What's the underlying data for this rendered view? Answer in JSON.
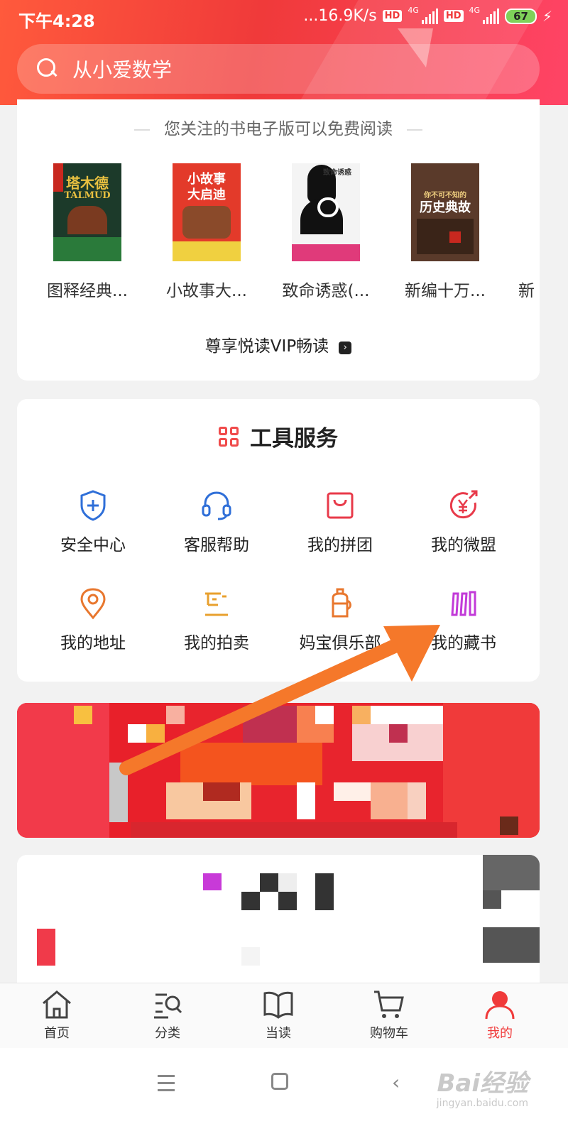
{
  "status_bar": {
    "time": "下午4:28",
    "speed": "...16.9K/s",
    "hd": "HD",
    "network": "4G",
    "battery": "67"
  },
  "search": {
    "placeholder": "从小爱数学"
  },
  "free_section": {
    "title": "您关注的书电子版可以免费阅读",
    "books": [
      {
        "label": "图释经典...",
        "cover_title": "塔木德",
        "cover_sub": "TALMUD"
      },
      {
        "label": "小故事大...",
        "cover_title": "小故事",
        "cover_sub": "大启迪"
      },
      {
        "label": "致命诱惑(...",
        "cover_title": "致命诱惑",
        "cover_sub": ""
      },
      {
        "label": "新编十万...",
        "cover_title": "历史典故",
        "cover_sub": "你不可不知的"
      },
      {
        "label": "新",
        "cover_title": "",
        "cover_sub": ""
      }
    ],
    "vip_link": "尊享悦读VIP畅读"
  },
  "tools": {
    "title": "工具服务",
    "items": [
      {
        "label": "安全中心",
        "icon": "shield-plus-icon",
        "color": "#2f6fd8"
      },
      {
        "label": "客服帮助",
        "icon": "headset-icon",
        "color": "#2f6fd8"
      },
      {
        "label": "我的拼团",
        "icon": "shopping-bag-icon",
        "color": "#e83a4a"
      },
      {
        "label": "我的微盟",
        "icon": "yuan-arrow-icon",
        "color": "#e83a4a"
      },
      {
        "label": "我的地址",
        "icon": "location-pin-icon",
        "color": "#e8772e"
      },
      {
        "label": "我的拍卖",
        "icon": "gavel-icon",
        "color": "#e8a02e"
      },
      {
        "label": "妈宝俱乐部",
        "icon": "baby-bottle-icon",
        "color": "#e8772e"
      },
      {
        "label": "我的藏书",
        "icon": "bookshelf-icon",
        "color": "#c23ad8"
      }
    ]
  },
  "tab_bar": {
    "items": [
      {
        "label": "首页",
        "icon": "home-icon",
        "active": false
      },
      {
        "label": "分类",
        "icon": "category-search-icon",
        "active": false
      },
      {
        "label": "当读",
        "icon": "open-book-icon",
        "active": false
      },
      {
        "label": "购物车",
        "icon": "cart-icon",
        "active": false
      },
      {
        "label": "我的",
        "icon": "user-icon",
        "active": true
      }
    ]
  },
  "watermark": {
    "brand": "Bai经验",
    "url": "jingyan.baidu.com"
  },
  "colors": {
    "accent": "#f03a3a",
    "pointer_arrow": "#f5782a"
  }
}
